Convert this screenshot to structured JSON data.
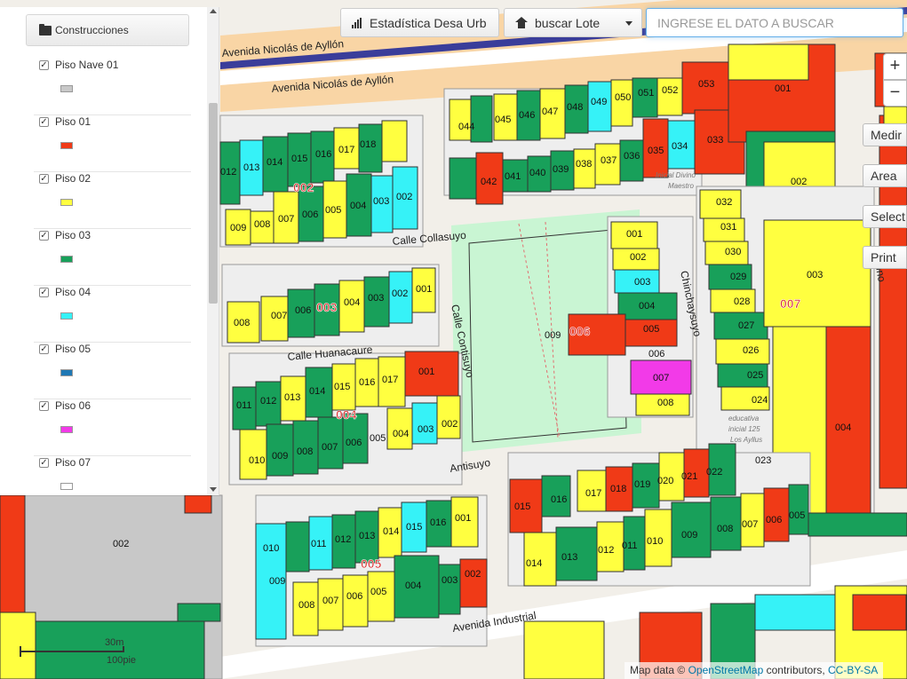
{
  "toolbar": {
    "stats_label": "Estadística Desa Urb",
    "search_type_label": "buscar Lote",
    "search_placeholder": "INGRESE EL DATO A BUSCAR",
    "search_value": ""
  },
  "legend": {
    "title": "Construcciones",
    "items": [
      {
        "name": "Piso Nave 01",
        "color": "#c8c8c8",
        "checked": true
      },
      {
        "name": "Piso 01",
        "color": "#f03a17",
        "checked": true
      },
      {
        "name": "Piso 02",
        "color": "#ffff40",
        "checked": true
      },
      {
        "name": "Piso 03",
        "color": "#18a05a",
        "checked": true
      },
      {
        "name": "Piso 04",
        "color": "#36f2f7",
        "checked": true
      },
      {
        "name": "Piso 05",
        "color": "#1f78b4",
        "checked": true
      },
      {
        "name": "Piso 06",
        "color": "#f23ae8",
        "checked": true
      },
      {
        "name": "Piso 07",
        "color": "#ffffff",
        "checked": true
      }
    ]
  },
  "zoom": {
    "in_label": "+",
    "out_label": "−"
  },
  "side_tools": {
    "measure": "Medir",
    "area": "Area",
    "select": "Select",
    "print": "Print"
  },
  "scale": {
    "metric": "30m",
    "imperial": "100pie"
  },
  "attribution": {
    "prefix": "Map data ©",
    "osm": "OpenStreetMap",
    "middle": "contributors,",
    "license": "CC-BY-SA"
  },
  "map": {
    "streets": {
      "ayllon_1": "Avenida Nicolás de Ayllón",
      "ayllon_2": "Avenida Nicolás de Ayllón",
      "collasuyo": "Calle Collasuyo",
      "huanacaure": "Calle Huanacaure",
      "contisuyo": "Calle Contisuyo",
      "chinchaysuyo": "Chinchaysuyo",
      "antisuyo": "Antisuyo",
      "industrial": "Avenida Industrial",
      "right_edge": "Cuno"
    },
    "manzanas": {
      "m002": "002",
      "m003": "003",
      "m004": "004",
      "m005": "005",
      "m006": "006",
      "m007": "007"
    },
    "pois": {
      "poi_divino_1": "Inicial Divino",
      "poi_divino_2": "Maestro",
      "poi_125_1": "educativa",
      "poi_125_2": "inicial 125",
      "poi_125_3": "Los Ayllus"
    },
    "lot_labels": {
      "top_row": [
        "053",
        "001",
        "052",
        "051",
        "050",
        "049",
        "048",
        "047",
        "046",
        "045",
        "044"
      ],
      "second_row": [
        "042",
        "041",
        "040",
        "039",
        "038",
        "037",
        "036",
        "035",
        "034",
        "033",
        "002"
      ],
      "m002_top": [
        "017",
        "018",
        "016",
        "015",
        "014",
        "013",
        "012"
      ],
      "m002_bottom": [
        "009",
        "008",
        "007",
        "006",
        "005",
        "004",
        "003",
        "002"
      ],
      "m003": [
        "008",
        "007",
        "006",
        "004",
        "003",
        "002",
        "001"
      ],
      "m004_top": [
        "011",
        "012",
        "013",
        "014",
        "015",
        "016",
        "017",
        "001"
      ],
      "m004_bottom": [
        "010",
        "009",
        "008",
        "007",
        "006",
        "005",
        "004",
        "003",
        "002"
      ],
      "m006": [
        "001",
        "002",
        "003",
        "004",
        "005",
        "009",
        "006",
        "007",
        "008"
      ],
      "m007_col": [
        "032",
        "031",
        "030",
        "029",
        "028",
        "027",
        "026",
        "025",
        "024",
        "003",
        "004"
      ],
      "m005_top": [
        "010",
        "011",
        "012",
        "013",
        "014",
        "015",
        "016",
        "001"
      ],
      "m005_bottom": [
        "009",
        "008",
        "007",
        "006",
        "005",
        "004",
        "003",
        "002"
      ],
      "right_block_top": [
        "023",
        "022",
        "021",
        "020",
        "019",
        "018",
        "017",
        "016",
        "015"
      ],
      "right_block_bottom": [
        "014",
        "013",
        "012",
        "011",
        "010",
        "009",
        "008",
        "007",
        "006",
        "005"
      ],
      "left_lot": "002"
    }
  }
}
